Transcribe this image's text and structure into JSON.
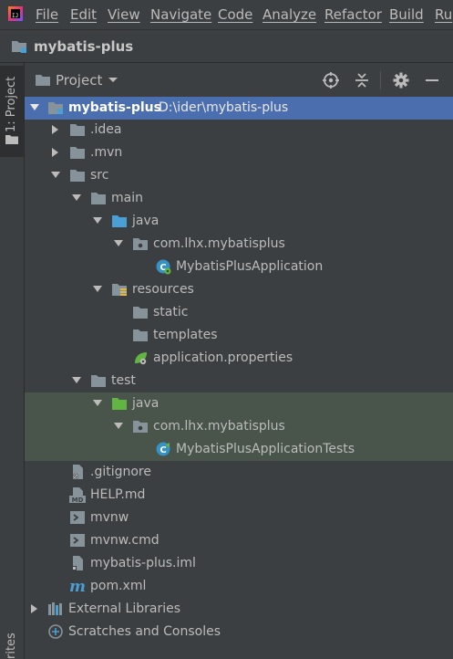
{
  "menubar": {
    "items": [
      "File",
      "Edit",
      "View",
      "Navigate",
      "Code",
      "Analyze",
      "Refactor",
      "Build",
      "Ru"
    ]
  },
  "navbar": {
    "project_name": "mybatis-plus"
  },
  "stripe": {
    "project_tab": "1: Project",
    "favorites_tab": "rites"
  },
  "toolwindow": {
    "title": "Project",
    "icons": [
      "locate-icon",
      "collapse-all-icon",
      "gear-icon",
      "minimize-icon"
    ]
  },
  "tree": [
    {
      "label": "mybatis-plus",
      "path": "D:\\ider\\mybatis-plus",
      "icon": "module-folder-icon",
      "expanded": true,
      "selected": true
    },
    {
      "label": ".idea",
      "icon": "folder-icon",
      "expanded": false
    },
    {
      "label": ".mvn",
      "icon": "folder-icon",
      "expanded": false
    },
    {
      "label": "src",
      "icon": "folder-icon",
      "expanded": true
    },
    {
      "label": "main",
      "icon": "folder-icon",
      "expanded": true
    },
    {
      "label": "java",
      "icon": "source-root-icon",
      "expanded": true
    },
    {
      "label": "com.lhx.mybatisplus",
      "icon": "package-icon",
      "expanded": true
    },
    {
      "label": "MybatisPlusApplication",
      "icon": "spring-boot-class-icon"
    },
    {
      "label": "resources",
      "icon": "resources-folder-icon",
      "expanded": true
    },
    {
      "label": "static",
      "icon": "folder-icon"
    },
    {
      "label": "templates",
      "icon": "folder-icon"
    },
    {
      "label": "application.properties",
      "icon": "spring-properties-icon"
    },
    {
      "label": "test",
      "icon": "folder-icon",
      "expanded": true
    },
    {
      "label": "java",
      "icon": "test-source-root-icon",
      "expanded": true
    },
    {
      "label": "com.lhx.mybatisplus",
      "icon": "package-icon",
      "expanded": true
    },
    {
      "label": "MybatisPlusApplicationTests",
      "icon": "test-class-icon"
    },
    {
      "label": ".gitignore",
      "icon": "gitignore-file-icon"
    },
    {
      "label": "HELP.md",
      "icon": "markdown-file-icon"
    },
    {
      "label": "mvnw",
      "icon": "shell-script-icon"
    },
    {
      "label": "mvnw.cmd",
      "icon": "cmd-file-icon"
    },
    {
      "label": "mybatis-plus.iml",
      "icon": "iml-file-icon"
    },
    {
      "label": "pom.xml",
      "icon": "maven-icon"
    },
    {
      "label": "External Libraries",
      "icon": "libraries-icon",
      "expanded": false
    },
    {
      "label": "Scratches and Consoles",
      "icon": "scratches-icon"
    }
  ],
  "colors": {
    "background": "#3c3f41",
    "selection": "#4b6eaf",
    "test_highlight": "#49544a",
    "folder": "#87939a",
    "source_root": "#4a9fd4",
    "test_root": "#62b543",
    "text": "#bbbbbb"
  }
}
